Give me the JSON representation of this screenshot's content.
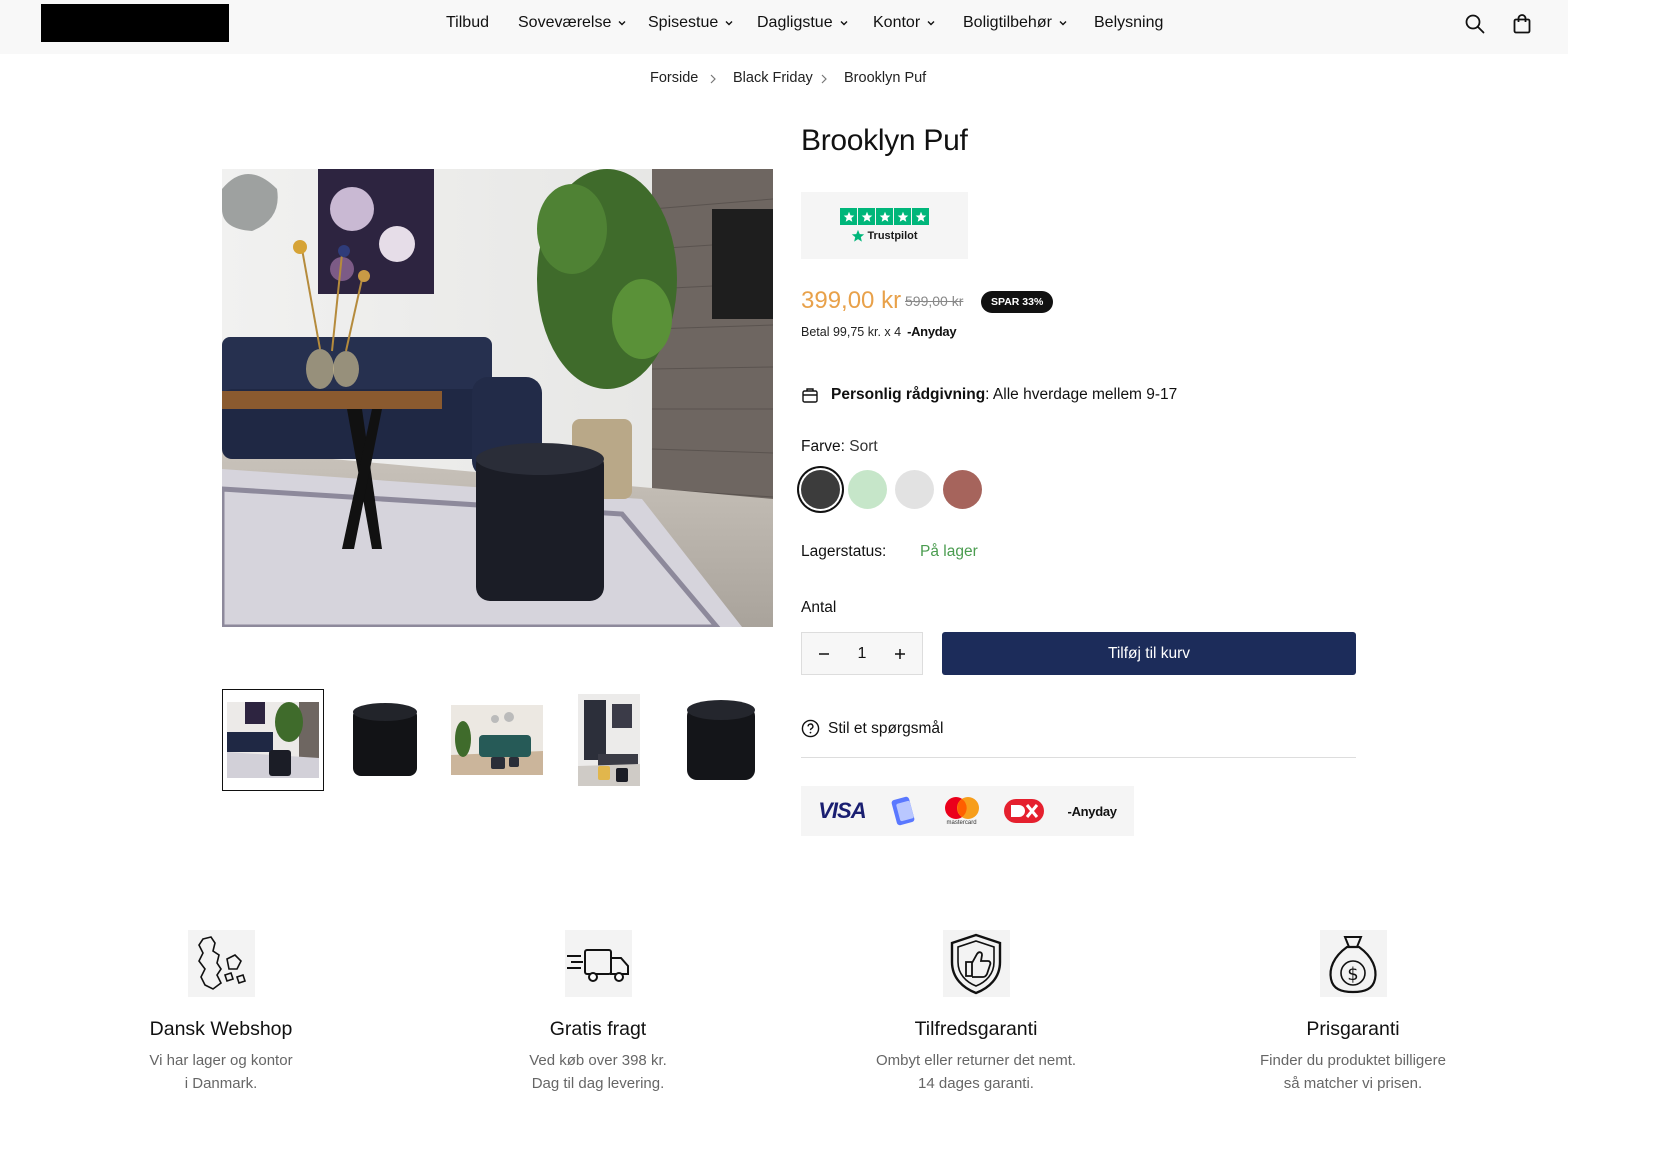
{
  "header": {
    "nav": [
      {
        "label": "Tilbud",
        "dropdown": false
      },
      {
        "label": "Soveværelse",
        "dropdown": true
      },
      {
        "label": "Spisestue",
        "dropdown": true
      },
      {
        "label": "Dagligstue",
        "dropdown": true
      },
      {
        "label": "Kontor",
        "dropdown": true
      },
      {
        "label": "Boligtilbehør",
        "dropdown": true
      },
      {
        "label": "Belysning",
        "dropdown": false
      }
    ],
    "icons": [
      "search-icon",
      "cart-icon"
    ]
  },
  "breadcrumb": [
    "Forside",
    "Black Friday",
    "Brooklyn Puf"
  ],
  "product": {
    "title": "Brooklyn Puf",
    "trustpilot_label": "Trustpilot",
    "price": "399,00 kr",
    "old_price": "599,00 kr",
    "save_badge": "SPAR 33%",
    "installment_text": "Betal 99,75 kr. x 4",
    "installment_provider": "Anyday",
    "advice_bold": "Personlig rådgivning",
    "advice_text": ": Alle hverdage mellem 9-17",
    "color_label": "Farve:",
    "color_value": "Sort",
    "swatches": [
      {
        "name": "Sort",
        "color": "#3c3c3c",
        "selected": true
      },
      {
        "name": "Grøn",
        "color": "#c6e6c9",
        "selected": false
      },
      {
        "name": "Lysegrå",
        "color": "#e2e2e2",
        "selected": false
      },
      {
        "name": "Rosa",
        "color": "#a6645c",
        "selected": false
      }
    ],
    "stock_label": "Lagerstatus:",
    "stock_value": "På lager",
    "qty_label": "Antal",
    "qty_value": "1",
    "add_to_cart": "Tilføj til kurv",
    "ask_question": "Stil et spørgsmål",
    "payments": [
      "VISA",
      "MobilePay",
      "mastercard",
      "Dankort",
      "Anyday"
    ],
    "mastercard_label": "mastercard"
  },
  "colors": {
    "price": "#e8a14a",
    "button": "#1c2c5a",
    "stock": "#4a9c4f",
    "trustpilot": "#00b67a"
  },
  "features": [
    {
      "title": "Dansk Webshop",
      "line1": "Vi har lager og kontor",
      "line2": "i Danmark.",
      "icon": "denmark-map-icon"
    },
    {
      "title": "Gratis fragt",
      "line1": "Ved køb over 398 kr.",
      "line2": "Dag til dag levering.",
      "icon": "delivery-truck-icon"
    },
    {
      "title": "Tilfredsgaranti",
      "line1": "Ombyt eller returner det nemt.",
      "line2": "14 dages garanti.",
      "icon": "thumbs-up-shield-icon"
    },
    {
      "title": "Prisgaranti",
      "line1": "Finder du produktet billigere",
      "line2": "så matcher vi prisen.",
      "icon": "money-bag-icon"
    }
  ]
}
